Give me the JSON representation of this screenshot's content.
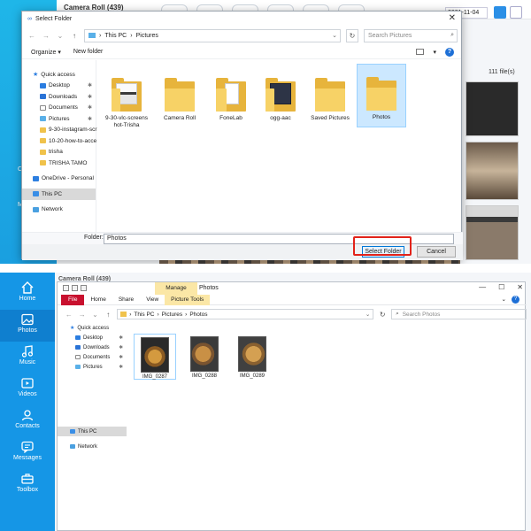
{
  "background_app": {
    "album_header": "Camera Roll (439)",
    "date_field": "2021-11-04",
    "file_count": "111 file(s)",
    "sidebar_partial": [
      "C",
      "M"
    ]
  },
  "select_folder_dialog": {
    "title": "Select Folder",
    "close_glyph": "✕",
    "address": {
      "segments": [
        "This PC",
        "Pictures"
      ]
    },
    "search_placeholder": "Search Pictures",
    "toolbar": {
      "organize": "Organize ▾",
      "new_folder": "New folder"
    },
    "nav_pane": [
      {
        "label": "Quick access",
        "icon": "star-icon"
      },
      {
        "label": "Desktop",
        "icon": "desktop-icon",
        "pinned": true
      },
      {
        "label": "Downloads",
        "icon": "download-icon",
        "pinned": true
      },
      {
        "label": "Documents",
        "icon": "document-icon",
        "pinned": true
      },
      {
        "label": "Pictures",
        "icon": "pictures-icon",
        "pinned": true
      },
      {
        "label": "9-30-instagram-scr",
        "icon": "folder-icon"
      },
      {
        "label": "10-20-how-to-acce",
        "icon": "folder-icon"
      },
      {
        "label": "trisha",
        "icon": "folder-icon"
      },
      {
        "label": "TRISHA TAMO",
        "icon": "folder-icon"
      },
      {
        "label": "OneDrive - Personal",
        "icon": "cloud-icon"
      },
      {
        "label": "This PC",
        "icon": "pc-icon"
      },
      {
        "label": "Network",
        "icon": "network-icon"
      }
    ],
    "folders": [
      {
        "name": "9-30-vlc-screens hot-Trisha"
      },
      {
        "name": "Camera Roll"
      },
      {
        "name": "FoneLab"
      },
      {
        "name": "ogg-aac"
      },
      {
        "name": "Saved Pictures"
      },
      {
        "name": "Photos"
      }
    ],
    "folder_label": "Folder:",
    "folder_value": "Photos",
    "select_button": "Select Folder",
    "cancel_button": "Cancel"
  },
  "sidebar": {
    "items": [
      {
        "label": "Home",
        "icon": "home-icon"
      },
      {
        "label": "Photos",
        "icon": "photo-icon"
      },
      {
        "label": "Music",
        "icon": "music-icon"
      },
      {
        "label": "Videos",
        "icon": "video-icon"
      },
      {
        "label": "Contacts",
        "icon": "contacts-icon"
      },
      {
        "label": "Messages",
        "icon": "messages-icon"
      },
      {
        "label": "Toolbox",
        "icon": "toolbox-icon"
      }
    ]
  },
  "app_header": "Camera Roll (439)",
  "explorer": {
    "title": "Photos",
    "manage_tab": "Manage",
    "window_controls": [
      "—",
      "☐",
      "✕"
    ],
    "ribbon": {
      "file": "File",
      "home": "Home",
      "share": "Share",
      "view": "View",
      "picture_tools": "Picture Tools"
    },
    "address": {
      "segments": [
        "This PC",
        "Pictures",
        "Photos"
      ]
    },
    "search_placeholder": "Search Photos",
    "nav_pane": [
      {
        "label": "Quick access"
      },
      {
        "label": "Desktop"
      },
      {
        "label": "Downloads"
      },
      {
        "label": "Documents"
      },
      {
        "label": "Pictures"
      },
      {
        "label": "This PC"
      },
      {
        "label": "Network"
      }
    ],
    "photos": [
      {
        "name": "IMG_0287"
      },
      {
        "name": "IMG_0288"
      },
      {
        "name": "IMG_0289"
      }
    ]
  },
  "colors": {
    "sidebar_blue": "#1596e6",
    "highlight_red": "#e2231a",
    "selection_blue": "#cce8ff",
    "file_tab_red": "#c8102e"
  }
}
